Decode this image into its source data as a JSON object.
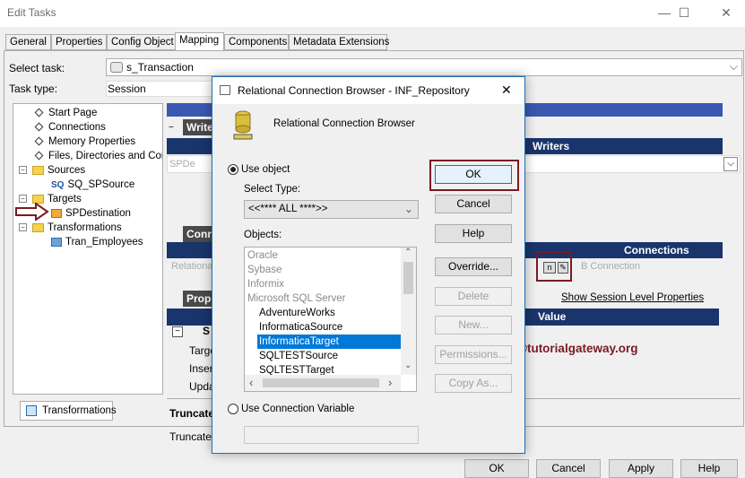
{
  "window": {
    "title": "Edit Tasks",
    "min_glyph": "—",
    "max_glyph": "☐",
    "close_glyph": "✕"
  },
  "tabs": [
    {
      "label": "General"
    },
    {
      "label": "Properties"
    },
    {
      "label": "Config Object"
    },
    {
      "label": "Mapping"
    },
    {
      "label": "Components"
    },
    {
      "label": "Metadata Extensions"
    }
  ],
  "select_task": {
    "label": "Select task:",
    "value": "s_Transaction"
  },
  "task_type": {
    "label": "Task type:",
    "value": "Session"
  },
  "tree": {
    "items": [
      {
        "label": "Start Page"
      },
      {
        "label": "Connections"
      },
      {
        "label": "Memory Properties"
      },
      {
        "label": "Files, Directories and Commands"
      },
      {
        "label": "Sources"
      },
      {
        "label": "SQ_SPSource",
        "prefix": "SQ"
      },
      {
        "label": "Targets"
      },
      {
        "label": "SPDestination"
      },
      {
        "label": "Transformations"
      },
      {
        "label": "Tran_Employees"
      }
    ],
    "bottom_tab": "Transformations"
  },
  "background_panel": {
    "writers_section": "Writers",
    "writers_header": "Writers",
    "writer_row": "SPDe",
    "connections_section": "Conn",
    "connections_header": "Connections",
    "relational_label": "Relational",
    "conn_value": "B Connection",
    "properties_section": "Prop",
    "show_session_link": "Show Session Level Properties",
    "value_header": "Value",
    "row_letter": "S",
    "rows": [
      "Targe",
      "Insert",
      "Upda"
    ],
    "truncate_bold": "Truncate",
    "truncate_plain": "Truncate",
    "expand_glyph": "−",
    "combo_arrow": "⌵",
    "n_glyph": "n",
    "edit_glyph": "✎"
  },
  "dialog": {
    "title": "Relational Connection Browser - INF_Repository",
    "header_text": "Relational Connection Browser",
    "use_object_label": "Use object",
    "select_type_label": "Select Type:",
    "select_type_value": "<<**** ALL ****>>",
    "objects_label": "Objects:",
    "objects": [
      {
        "label": "Oracle",
        "level": 0,
        "gray": true
      },
      {
        "label": "Sybase",
        "level": 0,
        "gray": true
      },
      {
        "label": "Informix",
        "level": 0,
        "gray": true
      },
      {
        "label": "Microsoft SQL Server",
        "level": 0,
        "gray": true
      },
      {
        "label": "AdventureWorks",
        "level": 1
      },
      {
        "label": "InformaticaSource",
        "level": 1
      },
      {
        "label": "InformaticaTarget",
        "level": 1,
        "selected": true
      },
      {
        "label": "SQLTESTSource",
        "level": 1
      },
      {
        "label": "SQLTESTTarget",
        "level": 1
      }
    ],
    "use_conn_var_label": "Use Connection Variable",
    "buttons": {
      "ok": "OK",
      "cancel": "Cancel",
      "help": "Help",
      "override": "Override...",
      "delete": "Delete",
      "new": "New...",
      "permissions": "Permissions...",
      "copy_as": "Copy As..."
    },
    "close_glyph": "✕",
    "arrow_up": "⌃",
    "arrow_down": "⌄",
    "arrow_left": "‹",
    "arrow_right": "›"
  },
  "watermark": "©tutorialgateway.org",
  "footer_buttons": {
    "ok": "OK",
    "cancel": "Cancel",
    "apply": "Apply",
    "help": "Help"
  },
  "colors": {
    "accent_bar": "#19356b",
    "annotation_red": "#7a1a22",
    "selection": "#0078d7"
  }
}
